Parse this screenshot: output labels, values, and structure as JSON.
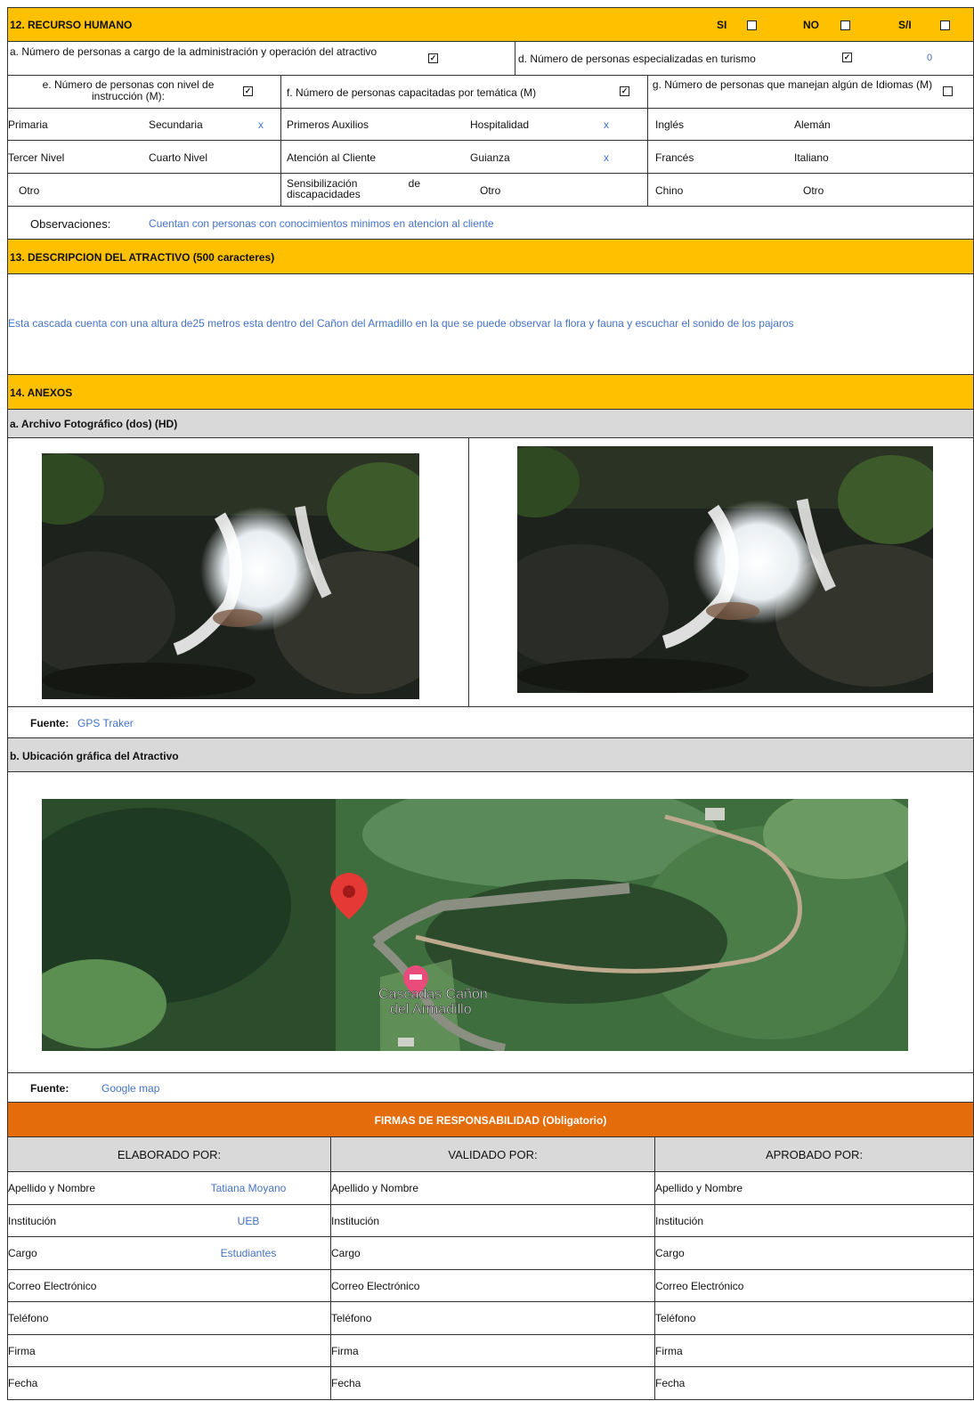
{
  "s12": {
    "title": "12. RECURSO HUMANO",
    "si": "SI",
    "no": "NO",
    "si_na": "S/I",
    "a_label": "a. Número de personas a cargo de la administración y operación del atractivo",
    "d_label": "d. Número de personas especializadas en turismo",
    "d_value": "0",
    "e_label": "e. Número de personas con nivel de instrucción (M):",
    "f_label": "f. Número de personas capacitadas por temática (M)",
    "g_label": "g. Número de personas que manejan algún de Idiomas (M)",
    "e_items": [
      "Primaria",
      "Secundaria",
      "Tercer Nivel",
      "Cuarto Nivel",
      "Otro"
    ],
    "e_mark": "x",
    "f_items": [
      "Primeros Auxilios",
      "Hospitalidad",
      "Atención al Cliente",
      "Guianza",
      "Sensibilización de discapacidades",
      "Otro"
    ],
    "f_mark_1": "x",
    "f_mark_2": "x",
    "g_items": [
      "Inglés",
      "Alemán",
      "Francés",
      "Italiano",
      "Chino",
      "Otro"
    ],
    "obs_label": "Observaciones:",
    "obs_value": "Cuentan con personas  con conocimientos minimos en atencion al cliente"
  },
  "s13": {
    "title": "13. DESCRIPCION DEL ATRACTIVO (500 caracteres)",
    "text": "Esta cascada cuenta con una altura de25 metros esta  dentro del  Cañon del Armadillo en la que se puede observar la flora y fauna y escuchar el  sonido  de los  pajaros"
  },
  "s14": {
    "title": "14. ANEXOS",
    "photo_title": "a. Archivo Fotográfico (dos) (HD)",
    "fuente_label": "Fuente:",
    "photo_source": "GPS Traker",
    "map_title": "b. Ubicación gráfica del Atractivo",
    "map_label_1": "Cascadas Cañón",
    "map_label_2": "del Armadillo",
    "map_source": "Google map"
  },
  "firmas": {
    "title": "FIRMAS DE RESPONSABILIDAD (Obligatorio)",
    "cols": [
      "ELABORADO POR:",
      "VALIDADO  POR:",
      "APROBADO POR:"
    ],
    "rows": [
      "Apellido y Nombre",
      "Institución",
      "Cargo",
      "Correo Electrónico",
      "Teléfono",
      "Firma",
      "Fecha"
    ],
    "elaborado_values": [
      "Tatiana Moyano",
      "UEB",
      "Estudiantes"
    ]
  },
  "colors": {
    "yellow": "#FFC000",
    "orange": "#E46C0A",
    "gray": "#D9D9D9",
    "blue_text": "#4472C4"
  }
}
